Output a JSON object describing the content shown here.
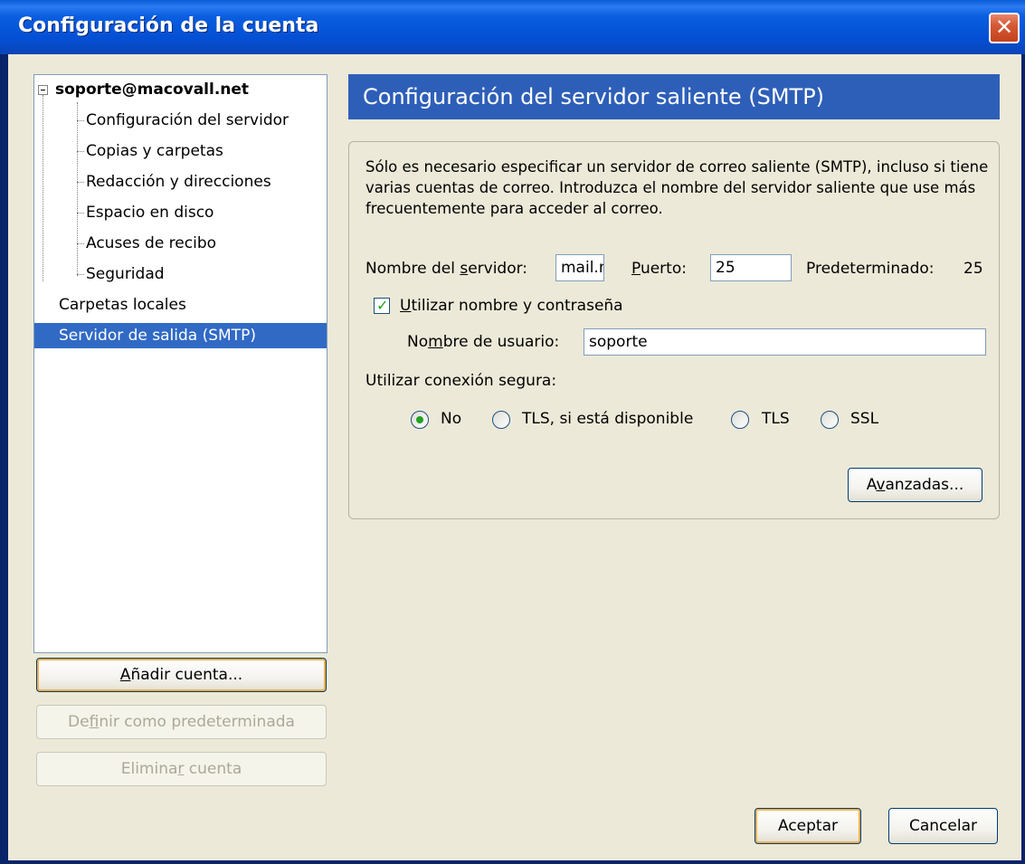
{
  "window": {
    "title": "Configuración de la cuenta",
    "close_glyph": "✕"
  },
  "tree": {
    "account": "soporte@macovall.net",
    "children": [
      "Configuración del servidor",
      "Copias y carpetas",
      "Redacción y direcciones",
      "Espacio en disco",
      "Acuses de recibo",
      "Seguridad"
    ],
    "local_folders": "Carpetas locales",
    "smtp": "Servidor de salida (SMTP)"
  },
  "left_buttons": {
    "add_account": {
      "pre": "",
      "key": "A",
      "post": "ñadir cuenta..."
    },
    "set_default": {
      "pre": "De",
      "key": "f",
      "post": "inir como predeterminada"
    },
    "delete_account": {
      "pre": "Elimina",
      "key": "r",
      "post": " cuenta"
    }
  },
  "panel": {
    "header": "Configuración del servidor saliente (SMTP)",
    "description": "Sólo es necesario especificar un servidor de correo saliente (SMTP), incluso si tiene varias cuentas de correo. Introduzca el nombre del servidor saliente que use más frecuentemente para acceder al correo.",
    "server_label": {
      "pre": "Nombre del ",
      "key": "s",
      "post": "ervidor:"
    },
    "server_value": "mail.macovall.net",
    "port_label": {
      "pre": "",
      "key": "P",
      "post": "uerto:"
    },
    "port_value": "25",
    "default_label": "Predeterminado:",
    "default_value": "25",
    "use_auth": {
      "pre": "",
      "key": "U",
      "post": "tilizar nombre y contraseña",
      "checked": true
    },
    "username_label": {
      "pre": "No",
      "key": "m",
      "post": "bre de usuario:"
    },
    "username_value": "soporte",
    "secure_label": "Utilizar conexión segura:",
    "secure_options": [
      "No",
      "TLS, si está disponible",
      "TLS",
      "SSL"
    ],
    "secure_selected": "No",
    "advanced_button": {
      "pre": "A",
      "key": "v",
      "post": "anzadas..."
    }
  },
  "footer": {
    "ok": "Aceptar",
    "cancel": "Cancelar"
  },
  "colors": {
    "selection": "#316ac5",
    "header": "#2e5fb8",
    "dialog_bg": "#ece9d8",
    "check": "#21a121"
  }
}
